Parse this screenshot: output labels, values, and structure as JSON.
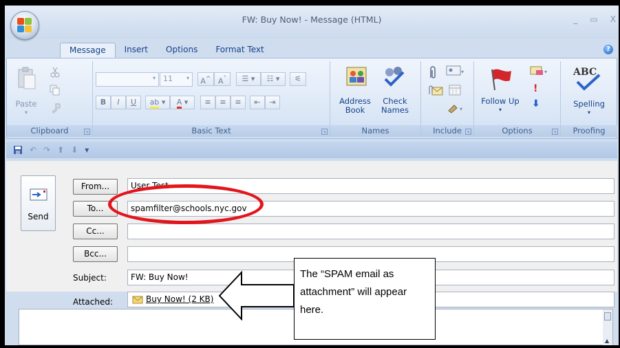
{
  "window": {
    "title": "FW: Buy Now! - Message (HTML)",
    "controls": [
      "_",
      "▭",
      "X"
    ]
  },
  "tabs": [
    {
      "label": "Message",
      "active": true
    },
    {
      "label": "Insert",
      "active": false
    },
    {
      "label": "Options",
      "active": false
    },
    {
      "label": "Format Text",
      "active": false
    }
  ],
  "ribbon": {
    "clipboard": {
      "paste_label": "Paste",
      "group_label": "Clipboard"
    },
    "basic_text": {
      "font_size": "11",
      "group_label": "Basic Text"
    },
    "names": {
      "address_book_label": "Address Book",
      "check_names_label": "Check Names",
      "group_label": "Names"
    },
    "include": {
      "group_label": "Include"
    },
    "options": {
      "follow_up_label": "Follow Up",
      "group_label": "Options"
    },
    "proofing": {
      "spelling_label": "Spelling",
      "group_label": "Proofing"
    }
  },
  "form": {
    "send_label": "Send",
    "from_button": "From...",
    "from_value": "User Test",
    "to_button": "To...",
    "to_value": "spamfilter@schools.nyc.gov",
    "cc_button": "Cc...",
    "cc_value": "",
    "bcc_button": "Bcc...",
    "bcc_value": "",
    "subject_label": "Subject:",
    "subject_value": "FW: Buy Now!",
    "attached_label": "Attached:",
    "attachment_name": "Buy Now! (2 KB)"
  },
  "annotation": {
    "callout_text": "The “SPAM email as attachment” will appear here."
  },
  "colors": {
    "ribbon_blue": "#dbe7f6",
    "tab_text": "#15428b",
    "annotation_red": "#e3151b"
  }
}
